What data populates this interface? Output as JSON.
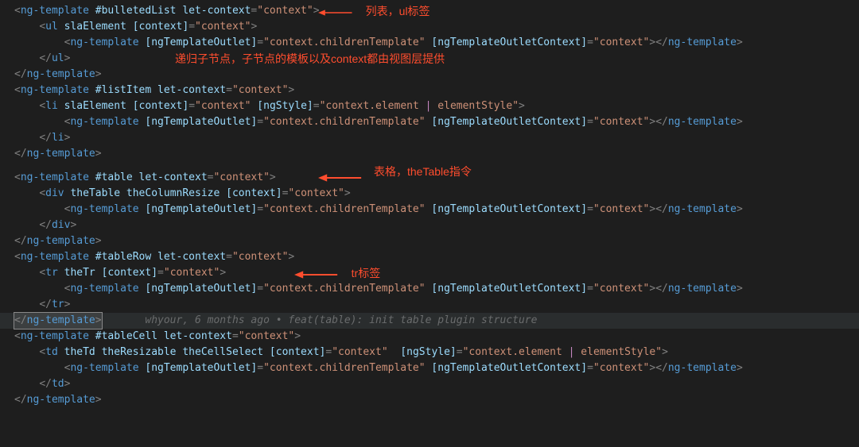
{
  "colors": {
    "bg": "#1e1e1e",
    "punct": "#808080",
    "tag": "#569cd6",
    "attr": "#9cdcfe",
    "string": "#ce9178",
    "pipe": "#c586c0",
    "annotation": "#ff4d2e",
    "blame": "#6a6c6d"
  },
  "annotations": {
    "a1": "列表，ul标签",
    "a2": "递归子节点，子节点的模板以及context都由视图层提供",
    "a3": "表格，theTable指令",
    "a4": "tr标签"
  },
  "blame": "whyour, 6 months ago • feat(table): init table plugin structure",
  "tokens": {
    "lt": "<",
    "gt": ">",
    "lts": "</",
    "gts": "/>",
    "eq": "=",
    "sp": " ",
    "q": "\"",
    "lb": "[",
    "rb": "]",
    "pipe": "|",
    "ngTemplate": "ng-template",
    "ul": "ul",
    "li": "li",
    "div": "div",
    "tr": "tr",
    "td": "td",
    "bulletedList": "#bulletedList",
    "listItem": "#listItem",
    "table": "#table",
    "tableRow": "#tableRow",
    "tableCell": "#tableCell",
    "letContext": "let-context",
    "slaElement": "slaElement",
    "theTable": "theTable",
    "theColumnResize": "theColumnResize",
    "theTr": "theTr",
    "theTd": "theTd",
    "theResizable": "theResizable",
    "theCellSelect": "theCellSelect",
    "ngStyleL": "[ngStyle]",
    "contextL": "[context]",
    "ngTplOutletL": "[ngTemplateOutlet]",
    "ngTplOutletCtxL": "[ngTemplateOutletContext]",
    "contextStr": "\"context\"",
    "childrenTpl": "\"context.childrenTemplate\"",
    "elemPipe": "\"context.element | elementStyle\"",
    "elemPipe_p1": "\"context.element ",
    "elemPipe_p2": " elementStyle\""
  }
}
